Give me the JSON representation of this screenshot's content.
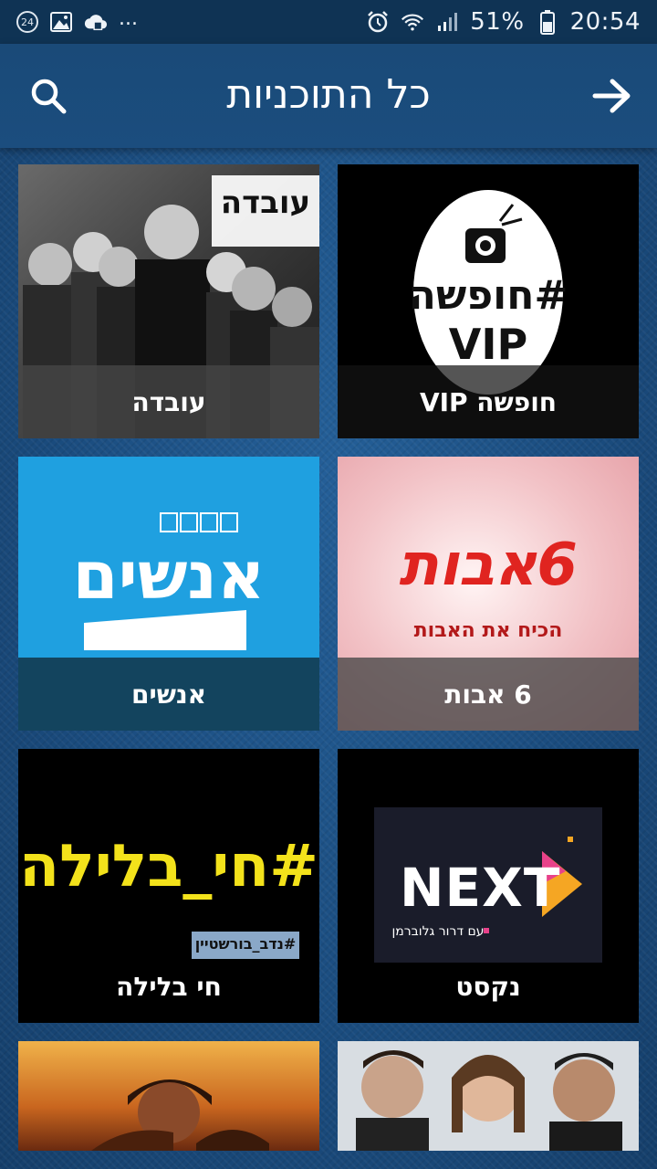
{
  "status_bar": {
    "notification_count": "24",
    "overflow": "...",
    "battery": "51%",
    "time": "20:54",
    "icons": [
      "notification-count-icon",
      "gallery-icon",
      "cloud-sync-icon",
      "alarm-icon",
      "wifi-icon",
      "signal-icon",
      "battery-icon"
    ]
  },
  "app_bar": {
    "title": "כל התוכניות",
    "search_icon": "search-icon",
    "back_icon": "arrow-right-icon"
  },
  "programs": [
    {
      "title": "חופשה VIP",
      "logo_text_line1": "#חופשה",
      "logo_text_line2": "VIP"
    },
    {
      "title": "עובדה",
      "logo_text": "עובדה"
    },
    {
      "title": "6 אבות",
      "logo_text": "6אבות",
      "logo_subtitle": "הכיח את האבות"
    },
    {
      "title": "אנשים",
      "logo_text": "אנשים"
    },
    {
      "title": "נקסט",
      "logo_text": "NEXT",
      "logo_subtitle": "עם דרור גלוברמן"
    },
    {
      "title": "חי בלילה",
      "logo_text": "#חי_בלילה",
      "logo_subtitle": "#נדב_בורשטיין"
    },
    {
      "title": ""
    },
    {
      "title": ""
    }
  ],
  "colors": {
    "background": "#1b4f82",
    "status_bar": "#0f3354",
    "app_bar": "#1a4a78",
    "anashim_blue": "#1fa0e0",
    "hai_yellow": "#f3e21b"
  }
}
